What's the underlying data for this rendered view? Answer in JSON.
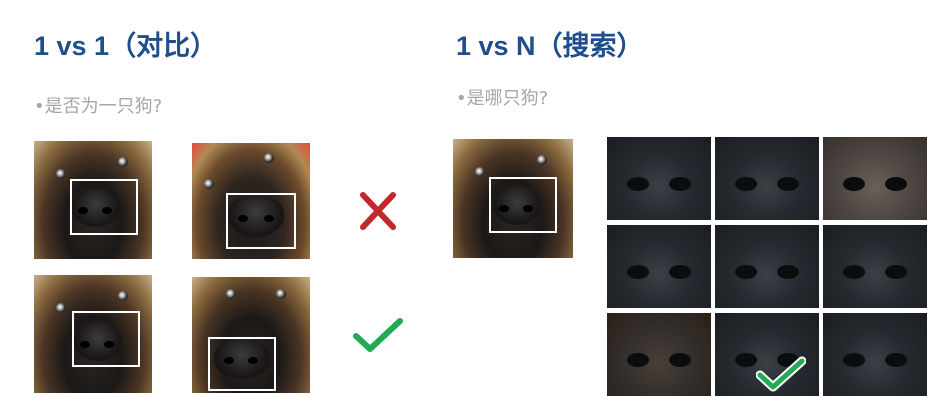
{
  "left": {
    "title": "1 vs 1（对比）",
    "subtitle": "•是否为一只狗?"
  },
  "right": {
    "title": "1 vs N（搜索）",
    "subtitle": "•是哪只狗?"
  },
  "colors": {
    "title": "#1f4e8c",
    "subtitle": "#a6a6a6",
    "cross": "#c0282a",
    "check": "#22aa55"
  },
  "icons": {
    "mismatch": "cross-icon",
    "match": "checkmark-icon"
  }
}
